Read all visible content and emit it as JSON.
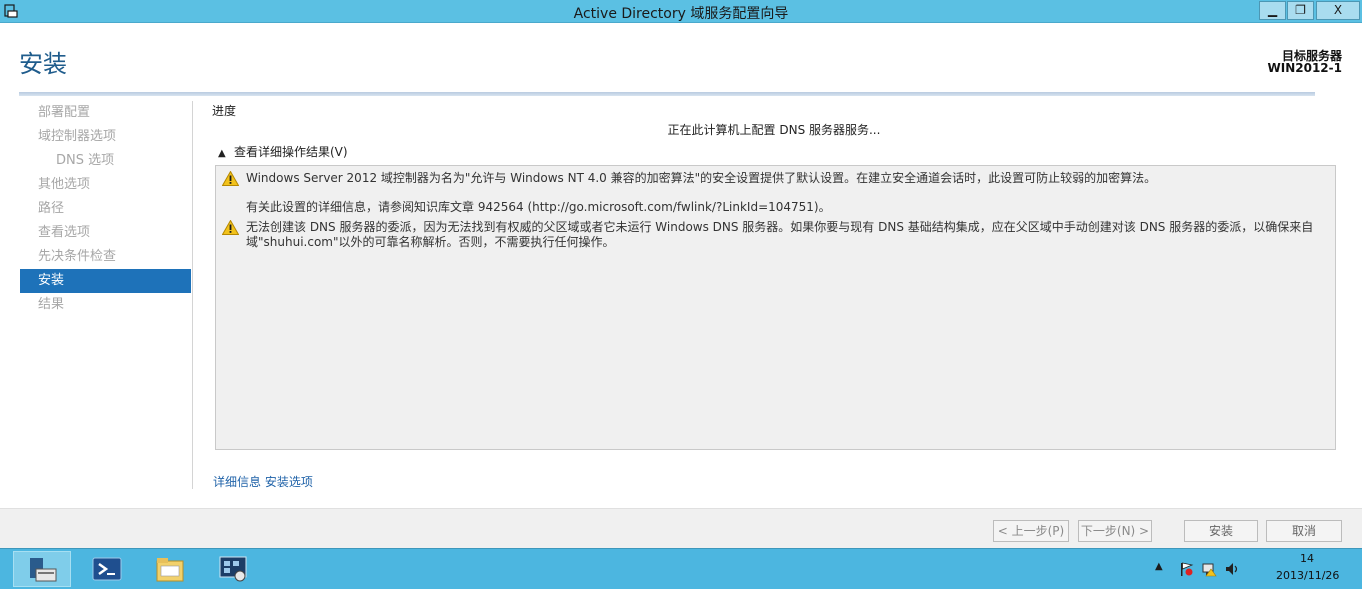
{
  "window": {
    "title": "Active Directory 域服务配置向导",
    "minimize": "▁",
    "maximize": "❐",
    "close": "X"
  },
  "header": {
    "title": "安装",
    "target_label": "目标服务器",
    "target_name": "WIN2012-1"
  },
  "nav": {
    "items": [
      {
        "label": "部署配置",
        "state": "disabled"
      },
      {
        "label": "域控制器选项",
        "state": "disabled"
      },
      {
        "label": "DNS 选项",
        "state": "disabled"
      },
      {
        "label": "其他选项",
        "state": "disabled"
      },
      {
        "label": "路径",
        "state": "disabled"
      },
      {
        "label": "查看选项",
        "state": "disabled"
      },
      {
        "label": "先决条件检查",
        "state": "disabled"
      },
      {
        "label": "安装",
        "state": "active"
      },
      {
        "label": "结果",
        "state": "disabled"
      }
    ]
  },
  "main": {
    "progress_label": "进度",
    "status": "正在此计算机上配置 DNS 服务器服务...",
    "details_toggle": "查看详细操作结果(V)",
    "messages": [
      {
        "icon": "warning-icon",
        "line1": "Windows Server 2012 域控制器为名为\"允许与 Windows NT 4.0 兼容的加密算法\"的安全设置提供了默认设置。在建立安全通道会话时，此设置可防止较弱的加密算法。",
        "line2": "有关此设置的详细信息，请参阅知识库文章 942564 (http://go.microsoft.com/fwlink/?LinkId=104751)。"
      },
      {
        "icon": "warning-icon",
        "line1": "无法创建该 DNS 服务器的委派，因为无法找到有权威的父区域或者它未运行 Windows DNS 服务器。如果你要与现有 DNS 基础结构集成，应在父区域中手动创建对该 DNS 服务器的委派，以确保来自",
        "line2": "域\"shuhui.com\"以外的可靠名称解析。否则，不需要执行任何操作。"
      }
    ],
    "more_info_prefix": "详细信息",
    "more_info_link": "安装选项"
  },
  "buttons": {
    "prev": "< 上一步(P)",
    "next": "下一步(N) >",
    "install": "安装",
    "cancel": "取消"
  },
  "taskbar": {
    "time": "14",
    "date": "2013/11/26"
  },
  "colors": {
    "titlebar": "#5bc0e3",
    "accent": "#1e72b9",
    "link": "#1f62a8",
    "taskbar": "#4cb6e0"
  }
}
